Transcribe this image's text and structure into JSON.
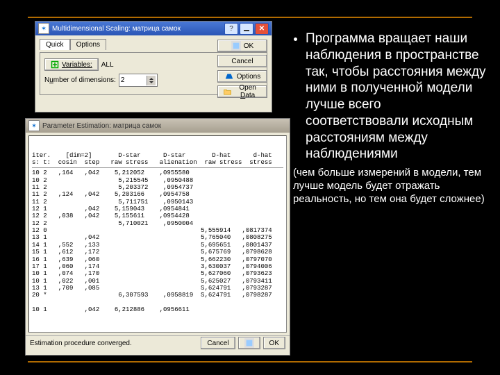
{
  "slide": {
    "main_text": "Программа вращает наши наблюдения в пространстве так, чтобы расстояния между ними в полученной модели лучше всего соответствовали исходным расстояниям между наблюдениями",
    "sub_text": "(чем больше измерений в модели, тем лучше модель будет отражать реальность, но тем она будет сложнее)"
  },
  "dialog1": {
    "title": "Multidimensional Scaling: матрица самок",
    "help": "?",
    "tabs": {
      "quick": "Quick",
      "options": "Options"
    },
    "variables_btn": "Variables:",
    "variables_value": "ALL",
    "numdim_label_pre": "N",
    "numdim_label_underline": "u",
    "numdim_label_post": "mber of dimensions:",
    "numdim_value": "2",
    "ok": "OK",
    "cancel": "Cancel",
    "options_btn": "Options",
    "opendata": "Open Data"
  },
  "dialog2": {
    "title": "Parameter Estimation: матрица самок",
    "header1": "iter.    [dim=2]       D-star      D-star       D-hat      d-hat",
    "header2": "s: t:  cosin  step   raw stress   alienation  raw stress  stress",
    "rows": [
      "10 2   ,164   ,042    5,212052    ,0955580",
      "10 2                   5,215545    ,0950488",
      "11 2                   5,203372    ,0954737",
      "11 2   ,124   ,042    5,203166    ,0954758",
      "11 2                   5,711751    ,0950143",
      "12 1          ,042    5,159043    ,0954841",
      "12 2   ,038   ,042    5,155611    ,0954428",
      "12 2                   5,710021    ,0950004",
      "12 0                                         5,555914   ,0817374",
      "13 1          ,042                           5,765040   ,0808275",
      "14 1   ,552   ,133                           5,695651   ,0801437",
      "15 1   ,612   ,172                           5,675769   ,0798628",
      "16 1   ,639   ,060                           5,662230   ,0797070",
      "17 1   ,060   ,174                           3,630037   ,0794006",
      "10 1   ,074   ,170                           5,627060   ,0793623",
      "10 1   ,022   ,001                           5,625027   ,0793411",
      "13 1   ,709   ,085                           S,624791   ,0793287",
      "20 *                   6,307593    ,0958819  S,624791   ,0798287",
      "",
      "10 1          ,042    6,212886    ,0956611"
    ],
    "status_text": "Estimation procedure converged.",
    "cancel": "Cancel",
    "ok": "OK"
  }
}
